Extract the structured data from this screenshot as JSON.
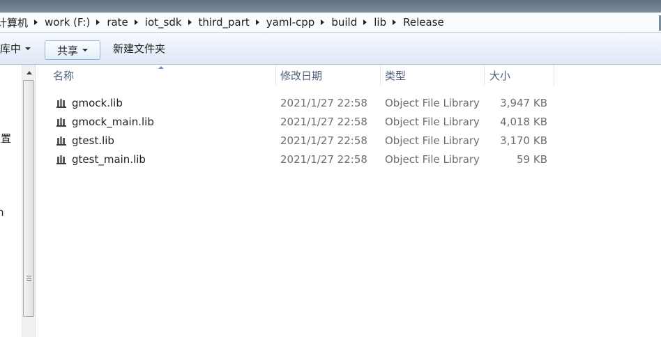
{
  "address": {
    "crumbs": [
      "计算机",
      "work (F:)",
      "rate",
      "iot_sdk",
      "third_part",
      "yaml-cpp",
      "build",
      "lib",
      "Release"
    ]
  },
  "toolbar": {
    "include_library_label": "到库中",
    "share_label": "共享",
    "new_folder_label": "新建文件夹"
  },
  "navpane": {
    "fragments": [
      "位置",
      "n"
    ]
  },
  "columns": {
    "name": "名称",
    "date": "修改日期",
    "type": "类型",
    "size": "大小"
  },
  "files": [
    {
      "name": "gmock.lib",
      "date": "2021/1/27 22:58",
      "type": "Object File Library",
      "size": "3,947 KB"
    },
    {
      "name": "gmock_main.lib",
      "date": "2021/1/27 22:58",
      "type": "Object File Library",
      "size": "4,018 KB"
    },
    {
      "name": "gtest.lib",
      "date": "2021/1/27 22:58",
      "type": "Object File Library",
      "size": "3,170 KB"
    },
    {
      "name": "gtest_main.lib",
      "date": "2021/1/27 22:58",
      "type": "Object File Library",
      "size": "59 KB"
    }
  ],
  "icons": {
    "file": "library-file-icon",
    "crumb_separator": "chevron-right-icon",
    "dropdown": "caret-down-icon",
    "sort": "sort-up-icon"
  },
  "colors": {
    "toolbar_top": "#f5f9fd",
    "toolbar_bottom": "#dde9f5",
    "header_text": "#4c607a",
    "secondary_text": "#6d6d6d"
  }
}
